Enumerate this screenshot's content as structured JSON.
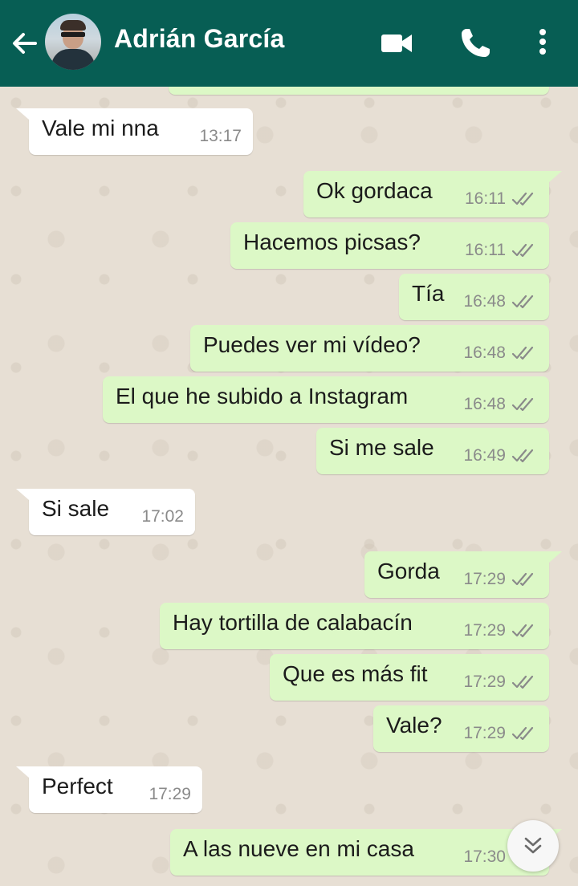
{
  "header": {
    "contact_name": "Adrián García",
    "background_color": "#075e54",
    "icons": {
      "back": "arrow-back-icon",
      "avatar": "profile-photo",
      "video": "video-call-icon",
      "phone": "voice-call-icon",
      "menu": "more-vert-icon"
    }
  },
  "colors": {
    "outgoing_bubble": "#dcf8c6",
    "incoming_bubble": "#ffffff",
    "chat_background": "#e6dfd5",
    "read_ticks": "#8a8a8a"
  },
  "messages": [
    {
      "direction": "in",
      "text": "Vale mi nna",
      "time": "13:17"
    },
    {
      "direction": "out",
      "text": "Ok gordaca",
      "time": "16:11"
    },
    {
      "direction": "out",
      "text": "Hacemos picsas?",
      "time": "16:11"
    },
    {
      "direction": "out",
      "text": "Tía",
      "time": "16:48"
    },
    {
      "direction": "out",
      "text": "Puedes ver mi vídeo?",
      "time": "16:48"
    },
    {
      "direction": "out",
      "text": "El que he subido a Instagram",
      "time": "16:48"
    },
    {
      "direction": "out",
      "text": "Si me sale",
      "time": "16:49"
    },
    {
      "direction": "in",
      "text": "Si sale",
      "time": "17:02"
    },
    {
      "direction": "out",
      "text": "Gorda",
      "time": "17:29"
    },
    {
      "direction": "out",
      "text": "Hay tortilla de calabacín",
      "time": "17:29"
    },
    {
      "direction": "out",
      "text": "Que es más fit",
      "time": "17:29"
    },
    {
      "direction": "out",
      "text": "Vale?",
      "time": "17:29"
    },
    {
      "direction": "in",
      "text": "Perfect",
      "time": "17:29"
    },
    {
      "direction": "out",
      "text": "A las nueve en mi casa",
      "time": "17:30"
    }
  ],
  "scroll_button_icon": "double-chevron-down-icon"
}
